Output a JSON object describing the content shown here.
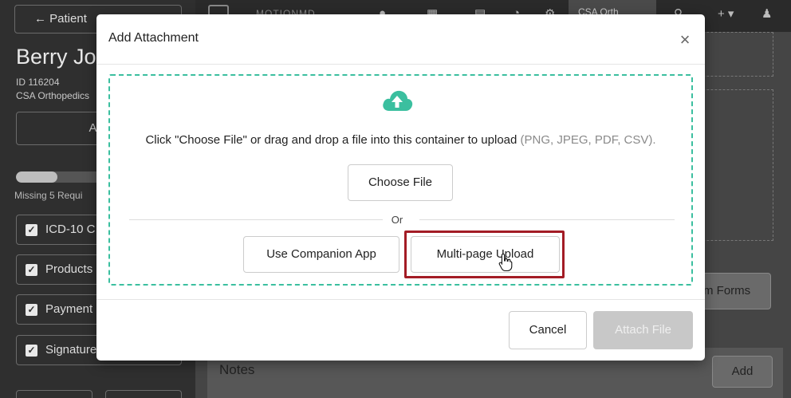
{
  "sidebar": {
    "back_label": "← Patient",
    "patient_name": "Berry Jo",
    "patient_id": "ID 116204",
    "clinic": "CSA Orthopedics",
    "actions_label": "Acti",
    "progress_fraction": 0.25,
    "missing_text": "Missing 5 Requi",
    "checklist": [
      {
        "label": "ICD-10 C",
        "checked": true
      },
      {
        "label": "Products",
        "checked": true
      },
      {
        "label": "Payment",
        "checked": true
      },
      {
        "label": "Signature",
        "checked": true
      }
    ]
  },
  "topnav": {
    "brand": "MOTIONMD",
    "tab_label": "CSA Orth",
    "plus_label": "+ ▾",
    "user_label": "▾"
  },
  "main": {
    "forms_label": "m Forms",
    "notes_label": "Notes",
    "add_label": "Add"
  },
  "modal": {
    "title": "Add Attachment",
    "close_label": "×",
    "instructions": "Click \"Choose File\" or drag and drop a file into this container to upload",
    "formats": "(PNG, JPEG, PDF, CSV).",
    "choose_label": "Choose File",
    "or_label": "Or",
    "companion_label": "Use Companion App",
    "multipage_label": "Multi-page Upload",
    "cancel_label": "Cancel",
    "attach_label": "Attach File"
  },
  "colors": {
    "accent": "#3bbf9f",
    "highlight": "#a31c25",
    "disabled": "#c8c8c8"
  },
  "icons": {
    "upload": "cloud-upload-icon",
    "cursor": "hand-pointer-icon",
    "close": "close-icon",
    "check": "checkbox-icon"
  }
}
